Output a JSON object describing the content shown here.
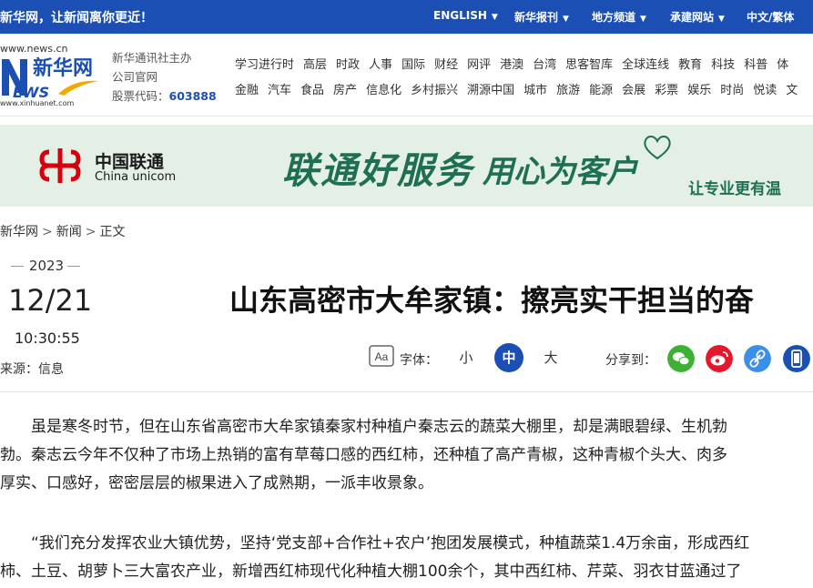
{
  "topbar": {
    "slogan": "新华网，让新闻离你更近！",
    "nav": [
      {
        "label": "ENGLISH"
      },
      {
        "label": "新华报刊"
      },
      {
        "label": "地方频道"
      },
      {
        "label": "承建网站"
      },
      {
        "label": "中文/繁体"
      }
    ]
  },
  "header": {
    "logo": {
      "url": "www.news.cn",
      "cn": "新华网",
      "news": "EWS",
      "n": "N",
      "domain": "www.xinhuanet.com"
    },
    "info_line1": "新华通讯社主办",
    "info_line2": "公司官网",
    "stock_label": "股票代码：",
    "stock_code": "603888",
    "categories_row1": [
      "学习进行时",
      "高层",
      "时政",
      "人事",
      "国际",
      "财经",
      "网评",
      "港澳",
      "台湾",
      "思客智库",
      "全球连线",
      "教育",
      "科技",
      "科普",
      "体"
    ],
    "categories_row2": [
      "金融",
      "汽车",
      "食品",
      "房产",
      "信息化",
      "乡村振兴",
      "溯源中国",
      "城市",
      "旅游",
      "能源",
      "会展",
      "彩票",
      "娱乐",
      "时尚",
      "悦读",
      "文"
    ]
  },
  "banner": {
    "brand_cn": "中国联通",
    "brand_en": "China unicom",
    "slogan1": "联通好服务",
    "slogan2": "用心为客户",
    "slogan3": "让专业更有温"
  },
  "breadcrumb": [
    "新华网",
    "新闻",
    "正文"
  ],
  "article": {
    "year": "2023",
    "date": "12/21",
    "time": "10:30:55",
    "source": "来源：信息",
    "title": "山东高密市大牟家镇：擦亮实干担当的奋",
    "font_size_label": "字体：",
    "font_sizes": [
      "小",
      "中",
      "大"
    ],
    "share_label": "分享到：",
    "paragraphs": [
      [
        "　　虽是寒冬时节，但在山东省高密市大牟家镇秦家村种植户秦志云的蔬菜大棚里，却是满眼碧绿、生机勃",
        "勃。秦志云今年不仅种了市场上热销的富有草莓口感的西红柿，还种植了高产青椒，这种青椒个头大、肉多",
        "厚实、口感好，密密层层的椒果进入了成熟期，一派丰收景象。"
      ],
      [
        "　　“我们充分发挥农业大镇优势，坚持‘党支部+合作社+农户’抱团发展模式，种植蔬菜1.4万余亩，形成西红",
        "柿、土豆、胡萝卜三大富农产业，新增西红柿现代化种植大棚100余个，其中西红柿、芹菜、羽衣甘蓝通过了"
      ]
    ]
  },
  "colors": {
    "brand_blue": "#1b4fb3",
    "banner_bg": "#e4f0e6",
    "banner_green": "#1f6f55"
  }
}
